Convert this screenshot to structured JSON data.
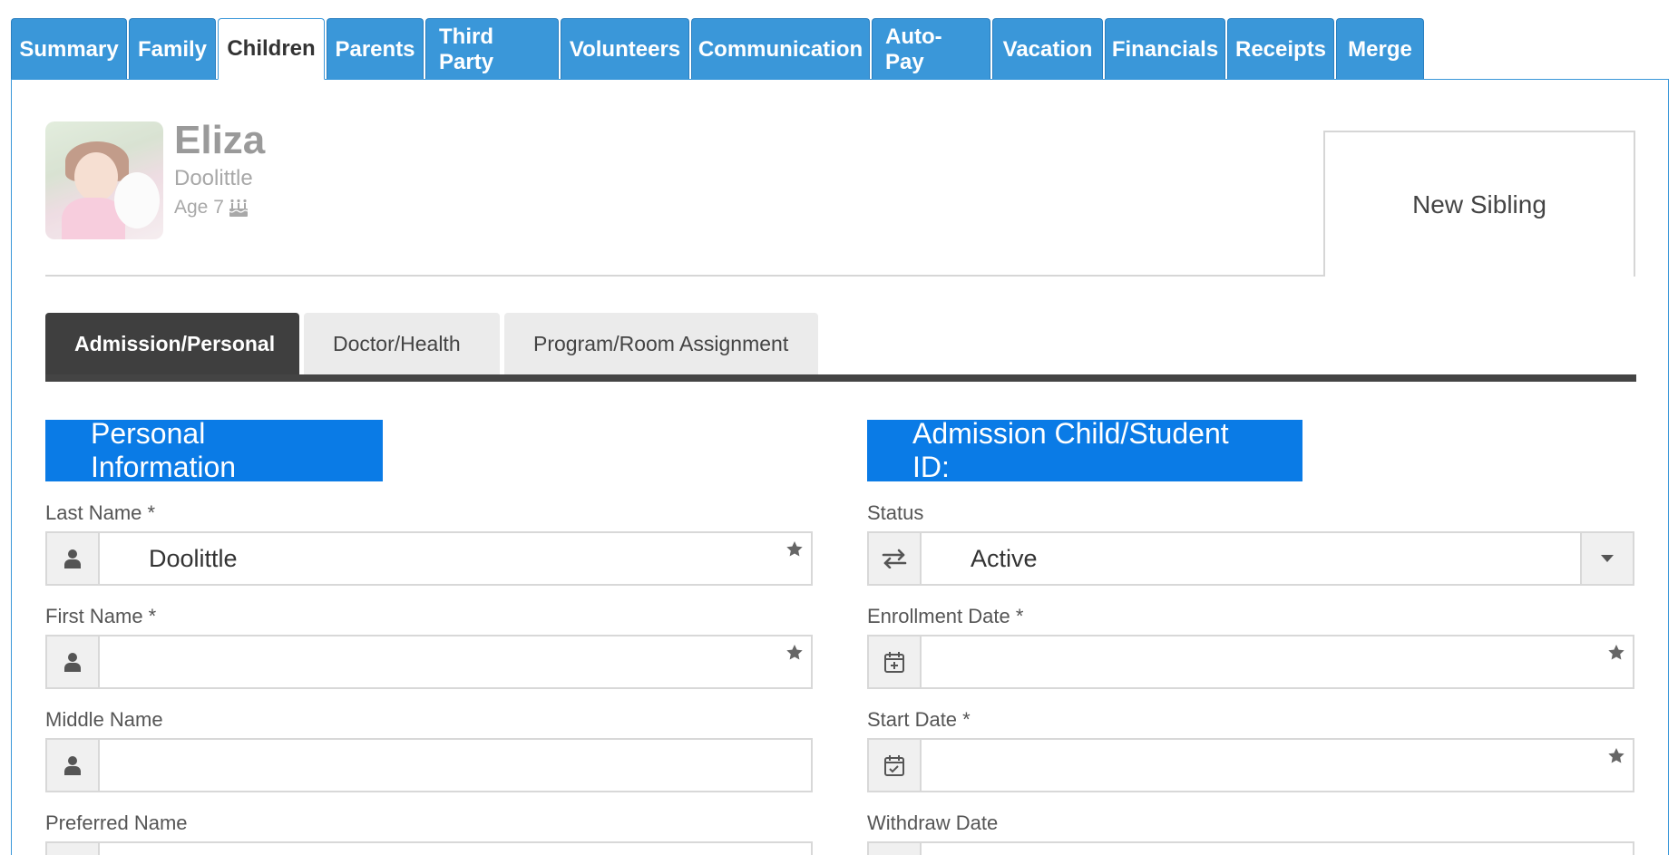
{
  "tabs": [
    {
      "label": "Summary"
    },
    {
      "label": "Family"
    },
    {
      "label": "Children",
      "active": true
    },
    {
      "label": "Parents"
    },
    {
      "label": "Third Party"
    },
    {
      "label": "Volunteers"
    },
    {
      "label": "Communication"
    },
    {
      "label": "Auto-Pay"
    },
    {
      "label": "Vacation"
    },
    {
      "label": "Financials"
    },
    {
      "label": "Receipts"
    },
    {
      "label": "Merge"
    }
  ],
  "child": {
    "first_name": "Eliza",
    "last_name": "Doolittle",
    "age": "Age 7"
  },
  "new_sibling_label": "New Sibling",
  "sub_tabs": [
    {
      "label": "Admission/Personal",
      "active": true
    },
    {
      "label": "Doctor/Health"
    },
    {
      "label": "Program/Room Assignment"
    }
  ],
  "personal": {
    "heading": "Personal Information",
    "last_name_label": "Last Name *",
    "last_name_value": "Doolittle",
    "first_name_label": "First Name *",
    "first_name_value": "",
    "middle_name_label": "Middle Name",
    "middle_name_value": "",
    "preferred_name_label": "Preferred Name"
  },
  "admission": {
    "heading": "Admission Child/Student ID:",
    "status_label": "Status",
    "status_value": "Active",
    "enrollment_label": "Enrollment Date  *",
    "enrollment_value": "",
    "start_label": "Start Date *",
    "start_value": "",
    "withdraw_label": "Withdraw Date"
  },
  "colors": {
    "tab_blue": "#3a97d9",
    "section_blue": "#0a7be6",
    "dark_tab": "#3f3f3f"
  },
  "icons": {
    "user": "user-icon",
    "required": "star-icon",
    "status": "swap-arrows-icon",
    "enrollment": "calendar-plus-icon",
    "start": "calendar-check-icon",
    "dropdown": "caret-down-icon",
    "age": "birthday-cake-icon"
  }
}
